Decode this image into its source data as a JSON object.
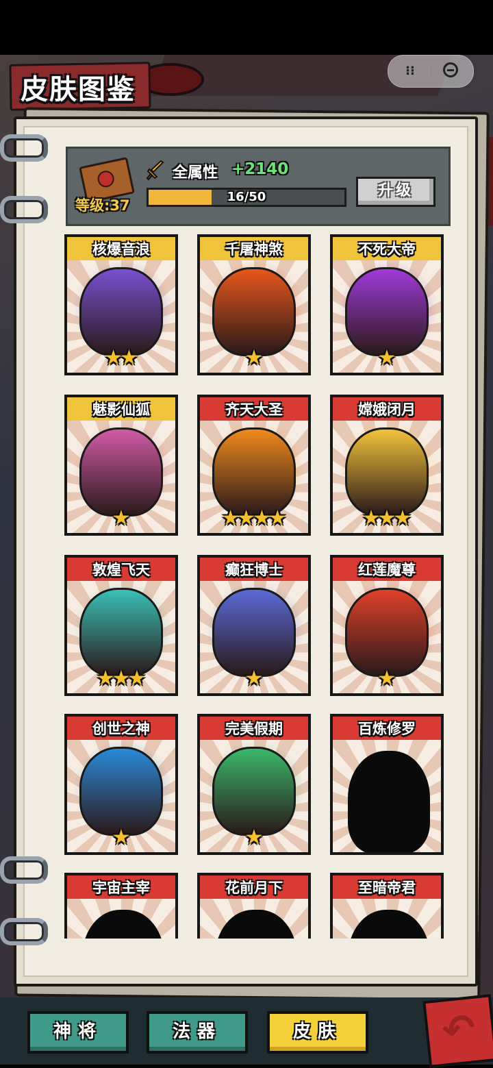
{
  "page": {
    "title": "皮肤图鉴"
  },
  "header": {
    "level_label": "等级:37",
    "attr_label": "全属性",
    "attr_value": "+2140",
    "progress_text": "16/50",
    "progress_fraction": 0.32,
    "upgrade_label": "升级"
  },
  "skins": [
    {
      "name": "核爆音浪",
      "stars": 2,
      "band": "gold",
      "locked": false,
      "hue": "#7a4fcf"
    },
    {
      "name": "千屠神煞",
      "stars": 1,
      "band": "gold",
      "locked": false,
      "hue": "#e8561c"
    },
    {
      "name": "不死大帝",
      "stars": 1,
      "band": "gold",
      "locked": false,
      "hue": "#a03ad8"
    },
    {
      "name": "魅影仙狐",
      "stars": 1,
      "band": "gold",
      "locked": false,
      "hue": "#d15aa8"
    },
    {
      "name": "齐天大圣",
      "stars": 4,
      "band": "red",
      "locked": false,
      "hue": "#f08a1c"
    },
    {
      "name": "嫦娥闭月",
      "stars": 3,
      "band": "red",
      "locked": false,
      "hue": "#f2c33a"
    },
    {
      "name": "敦煌飞天",
      "stars": 3,
      "band": "red",
      "locked": false,
      "hue": "#3ac0b8"
    },
    {
      "name": "癫狂博士",
      "stars": 1,
      "band": "red",
      "locked": false,
      "hue": "#5a6ad8"
    },
    {
      "name": "红莲魔尊",
      "stars": 1,
      "band": "red",
      "locked": false,
      "hue": "#e0402a"
    },
    {
      "name": "创世之神",
      "stars": 1,
      "band": "red",
      "locked": false,
      "hue": "#2a8ad8"
    },
    {
      "name": "完美假期",
      "stars": 1,
      "band": "red",
      "locked": false,
      "hue": "#3ab86a"
    },
    {
      "name": "百炼修罗",
      "stars": 0,
      "band": "red",
      "locked": true,
      "hue": "#111111"
    },
    {
      "name": "宇宙主宰",
      "stars": 0,
      "band": "red",
      "locked": true,
      "hue": "#111111"
    },
    {
      "name": "花前月下",
      "stars": 0,
      "band": "red",
      "locked": true,
      "hue": "#111111"
    },
    {
      "name": "至暗帝君",
      "stars": 0,
      "band": "red",
      "locked": true,
      "hue": "#111111"
    }
  ],
  "tabs": [
    {
      "label": "神将",
      "active": false
    },
    {
      "label": "法器",
      "active": false
    },
    {
      "label": "皮肤",
      "active": true
    }
  ],
  "icons": {
    "menu": "more-dots-icon",
    "close": "close-circle-icon",
    "back": "back-arrow-icon",
    "star": "star-icon",
    "sword": "sword-icon"
  }
}
